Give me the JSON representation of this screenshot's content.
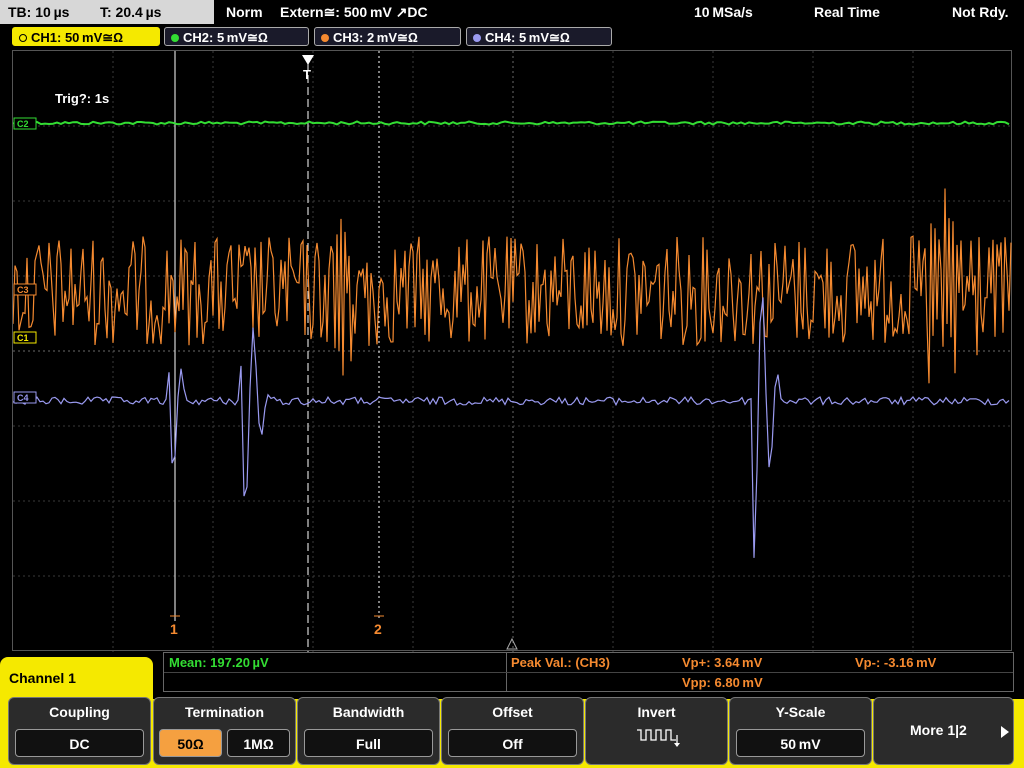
{
  "status": {
    "timebase": "TB: 10 µs",
    "trigger_time": "T: 20.4 µs",
    "mode": "Norm",
    "trigger_source": "Extern≅: 500 mV ↗DC",
    "sample_rate": "10 MSa/s",
    "acq_mode": "Real Time",
    "state": "Not Rdy."
  },
  "channels": [
    {
      "label": "CH1: 50 mV≅Ω",
      "color": "#f5e900"
    },
    {
      "label": "CH2: 5 mV≅Ω",
      "color": "#33dd33"
    },
    {
      "label": "CH3: 2 mV≅Ω",
      "color": "#f58a30"
    },
    {
      "label": "CH4: 5 mV≅Ω",
      "color": "#9a9af0"
    }
  ],
  "screen": {
    "trig_note": "Trig?: 1s",
    "cursor1": "1",
    "cursor2": "2",
    "trig_marker": "T",
    "ch_markers": [
      "C2",
      "C3",
      "C1",
      "C4"
    ]
  },
  "measurements": {
    "mean": "Mean: 197.20 µV",
    "peak_label": "Peak Val.:  (CH3)",
    "vp_plus": "Vp+: 3.64 mV",
    "vp_minus": "Vp-: -3.16 mV",
    "vpp": "Vpp: 6.80 mV"
  },
  "menu": {
    "channel_title": "Channel 1",
    "coupling_title": "Coupling",
    "coupling_value": "DC",
    "termination_title": "Termination",
    "termination_50": "50Ω",
    "termination_1m": "1MΩ",
    "bandwidth_title": "Bandwidth",
    "bandwidth_value": "Full",
    "offset_title": "Offset",
    "offset_value": "Off",
    "invert_title": "Invert",
    "yscale_title": "Y-Scale",
    "yscale_value": "50 mV",
    "more": "More 1|2"
  }
}
